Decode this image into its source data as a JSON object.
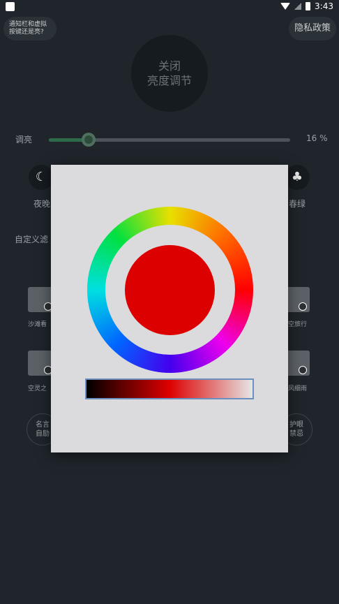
{
  "status_bar": {
    "time": "3:43"
  },
  "header": {
    "notice_line1": "通知栏和虚拟",
    "notice_line2": "按键还是亮?",
    "privacy": "隐私政策"
  },
  "main_button": {
    "line1": "关闭",
    "line2": "亮度调节"
  },
  "brightness": {
    "label": "调亮",
    "percent_text": "16 %",
    "value": 0.16
  },
  "modes": [
    {
      "label": "夜晚",
      "icon": "moon-icon"
    },
    {
      "label": "春绿",
      "icon": "tree-icon"
    }
  ],
  "custom_filter_label": "自定义滤",
  "thumbnails": [
    {
      "label": "沙滩看"
    },
    {
      "label": "空旅行"
    },
    {
      "label": "空灵之"
    },
    {
      "label": "风细雨"
    }
  ],
  "bottom_buttons": [
    {
      "line1": "名言",
      "line2": "自励"
    },
    {
      "line1": "护眼",
      "line2": "禁忌"
    }
  ],
  "color_picker": {
    "selected_color": "#dd0000",
    "gradient_start": "#000000",
    "gradient_end": "#e6e6e6"
  }
}
